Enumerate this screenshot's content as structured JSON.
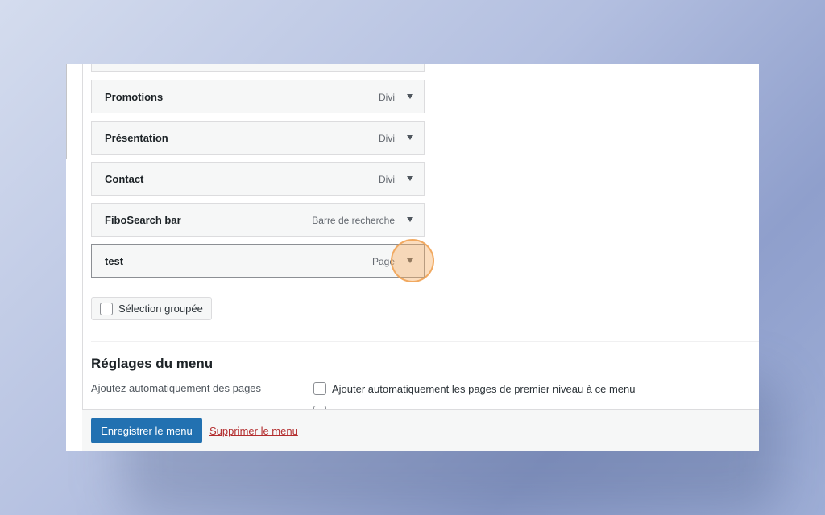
{
  "menu": {
    "items": [
      {
        "title": "",
        "type": ""
      },
      {
        "title": "Promotions",
        "type": "Divi"
      },
      {
        "title": "Présentation",
        "type": "Divi"
      },
      {
        "title": "Contact",
        "type": "Divi"
      },
      {
        "title": "FiboSearch bar",
        "type": "Barre de recherche"
      },
      {
        "title": "test",
        "type": "Page"
      }
    ],
    "bulk_select_label": "Sélection groupée"
  },
  "settings": {
    "title": "Réglages du menu",
    "auto_add_label": "Ajoutez automatiquement des pages",
    "auto_add_option": "Ajouter automatiquement les pages de premier niveau à ce menu"
  },
  "footer": {
    "save_label": "Enregistrer le menu",
    "delete_label": "Supprimer le menu"
  },
  "colors": {
    "primary": "#2271b1",
    "delete": "#b32d2e",
    "highlight": "#f0a050"
  },
  "icons": {
    "toggle": "triangle-down-icon"
  }
}
